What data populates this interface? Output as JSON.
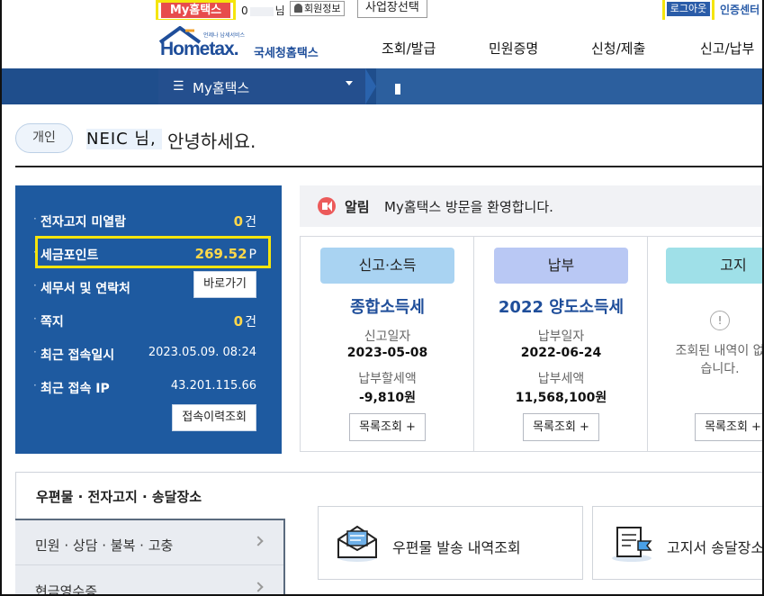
{
  "util": {
    "my_hometax": "My홈택스",
    "user_prefix": "0",
    "user_suffix": "님",
    "member_info": "회원정보",
    "biz_select": "사업장선택",
    "logout": "로그아웃",
    "cert_center": "인증센터"
  },
  "header": {
    "logo_tag": "언제나 납세서비스",
    "logo_main": "Hometax.",
    "logo_kor": "국세청홈택스",
    "menu": [
      "조회/발급",
      "민원증명",
      "신청/제출",
      "신고/납부"
    ]
  },
  "navbar": {
    "selected": "My홈택스"
  },
  "greeting": {
    "type": "개인",
    "name": "NEIC 님,",
    "hello": "안녕하세요."
  },
  "summary": {
    "rows": [
      {
        "label": "전자고지 미열람",
        "value": "0",
        "unit": "건"
      },
      {
        "label": "세금포인트",
        "value": "269.52",
        "unit": "P"
      },
      {
        "label": "세무서 및 연락처",
        "button": "바로가기"
      },
      {
        "label": "쪽지",
        "value": "0",
        "unit": "건"
      },
      {
        "label": "최근 접속일시",
        "text": "2023.05.09.  08:24"
      },
      {
        "label": "최근 접속 IP",
        "text": "43.201.115.66"
      }
    ],
    "history_button": "접속이력조회"
  },
  "notice": {
    "label": "알림",
    "message": "My홈택스 방문을 환영합니다."
  },
  "cards": [
    {
      "header": "신고·소득",
      "header_color": "#a9d3f2",
      "title": "종합소득세",
      "label1": "신고일자",
      "value1": "2023-05-08",
      "label2": "납부할세액",
      "value2": "-9,810원",
      "button": "목록조회 +"
    },
    {
      "header": "납부",
      "header_color": "#b9c8f4",
      "title": "2022 양도소득세",
      "label1": "납부일자",
      "value1": "2022-06-24",
      "label2": "납부세액",
      "value2": "11,568,100원",
      "button": "목록조회 +"
    },
    {
      "header": "고지",
      "header_color": "#9fe0e8",
      "message": "조회된 내역이 없습니다.",
      "button": "목록조회 +"
    }
  ],
  "section": {
    "tab_title": "우편물 · 전자고지 · 송달장소",
    "left_items": [
      "민원 · 상담 · 불복 · 고충",
      "현금영수증"
    ],
    "services": [
      "우편물 발송 내역조회",
      "고지서 송달장소"
    ]
  },
  "colors": {
    "nav_blue": "#1f4e8c",
    "panel_blue": "#1e5aa0",
    "highlight": "#f5e50c",
    "accent_red": "#e74c4c"
  }
}
